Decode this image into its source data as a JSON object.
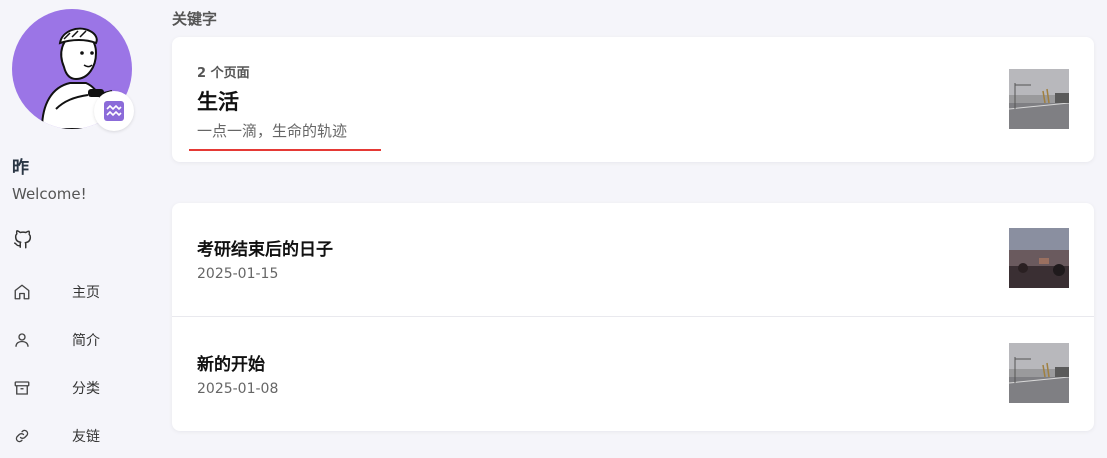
{
  "site": {
    "name": "昨",
    "subtitle": "Welcome!"
  },
  "nav": {
    "items": [
      {
        "label": "主页",
        "icon": "home-icon"
      },
      {
        "label": "简介",
        "icon": "user-icon"
      },
      {
        "label": "分类",
        "icon": "archive-icon"
      },
      {
        "label": "友链",
        "icon": "link-icon"
      }
    ]
  },
  "social": {
    "github_icon": "github-icon"
  },
  "main": {
    "section_title": "关键字",
    "keyword": {
      "count": "2 个页面",
      "title": "生活",
      "description": "一点一滴，生命的轨迹"
    },
    "articles": [
      {
        "title": "考研结束后的日子",
        "date": "2025-01-15"
      },
      {
        "title": "新的开始",
        "date": "2025-01-08"
      }
    ]
  },
  "colors": {
    "avatar_bg": "#9b75e6",
    "underline": "#e53935",
    "page_bg": "#f5f5fa"
  }
}
